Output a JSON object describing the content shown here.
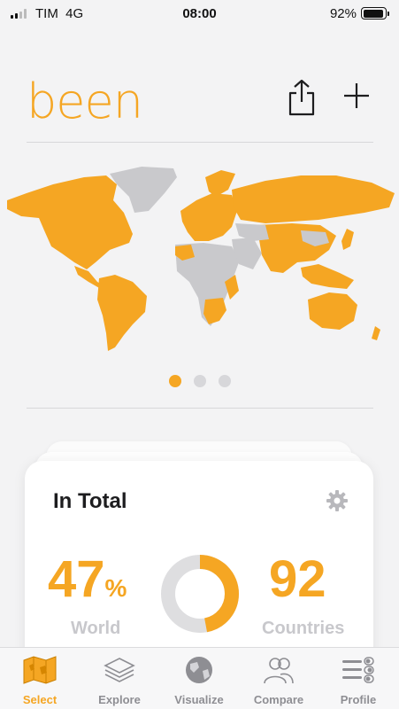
{
  "status_bar": {
    "carrier": "TIM",
    "network": "4G",
    "time": "08:00",
    "battery": "92%"
  },
  "header": {
    "logo": "been"
  },
  "map": {
    "pager_pages": 3,
    "pager_active": 1
  },
  "card": {
    "title": "In Total",
    "world_percent": "47",
    "percent_sign": "%",
    "world_label": "World",
    "countries_count": "92",
    "countries_label": "Countries",
    "donut_fraction": 0.47
  },
  "tabs": [
    {
      "label": "Select",
      "icon": "map-icon",
      "active": true
    },
    {
      "label": "Explore",
      "icon": "stack-icon",
      "active": false
    },
    {
      "label": "Visualize",
      "icon": "globe-icon",
      "active": false
    },
    {
      "label": "Compare",
      "icon": "people-icon",
      "active": false
    },
    {
      "label": "Profile",
      "icon": "profile-list-icon",
      "active": false
    }
  ],
  "colors": {
    "accent": "#f5a623",
    "unvisited": "#c9c9cc",
    "muted_label": "#c8c8cc"
  }
}
